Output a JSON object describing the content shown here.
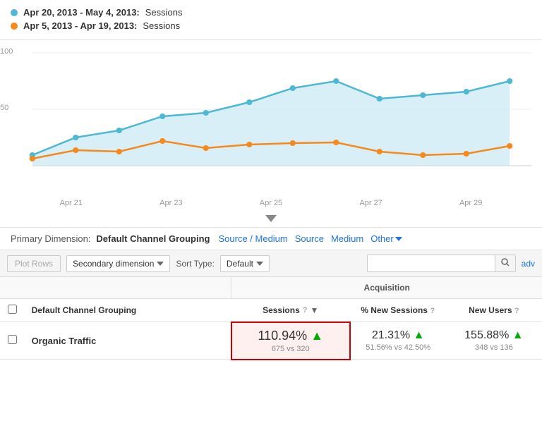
{
  "legend": {
    "item1": {
      "date": "Apr 20, 2013 - May 4, 2013:",
      "metric": "Sessions",
      "color": "#4db8d4"
    },
    "item2": {
      "date": "Apr 5, 2013 - Apr 19, 2013:",
      "metric": "Sessions",
      "color": "#f5891b"
    }
  },
  "chart": {
    "y_labels": [
      "100",
      "50"
    ],
    "x_labels": [
      "Apr 21",
      "Apr 23",
      "Apr 25",
      "Apr 27",
      "Apr 29"
    ]
  },
  "primary_dimension": {
    "label": "Primary Dimension:",
    "active": "Default Channel Grouping",
    "links": [
      "Source / Medium",
      "Source",
      "Medium"
    ],
    "other": "Other"
  },
  "toolbar": {
    "plot_rows": "Plot Rows",
    "secondary_dimension": "Secondary dimension",
    "sort_label": "Sort Type:",
    "sort_value": "Default",
    "search_placeholder": "",
    "adv_link": "adv"
  },
  "table": {
    "acquisition_header": "Acquisition",
    "columns": {
      "sessions": "Sessions",
      "new_sessions": "% New Sessions",
      "new_users": "New Users"
    },
    "rows": [
      {
        "name": "Organic Traffic",
        "sessions_pct": "110.94%",
        "sessions_change": "up",
        "sessions_vs": "675 vs 320",
        "new_sessions_pct": "21.31%",
        "new_sessions_change": "up",
        "new_sessions_vs": "51.56% vs 42.50%",
        "new_users_pct": "155.88%",
        "new_users_change": "up",
        "new_users_vs": "348 vs 136"
      }
    ]
  }
}
